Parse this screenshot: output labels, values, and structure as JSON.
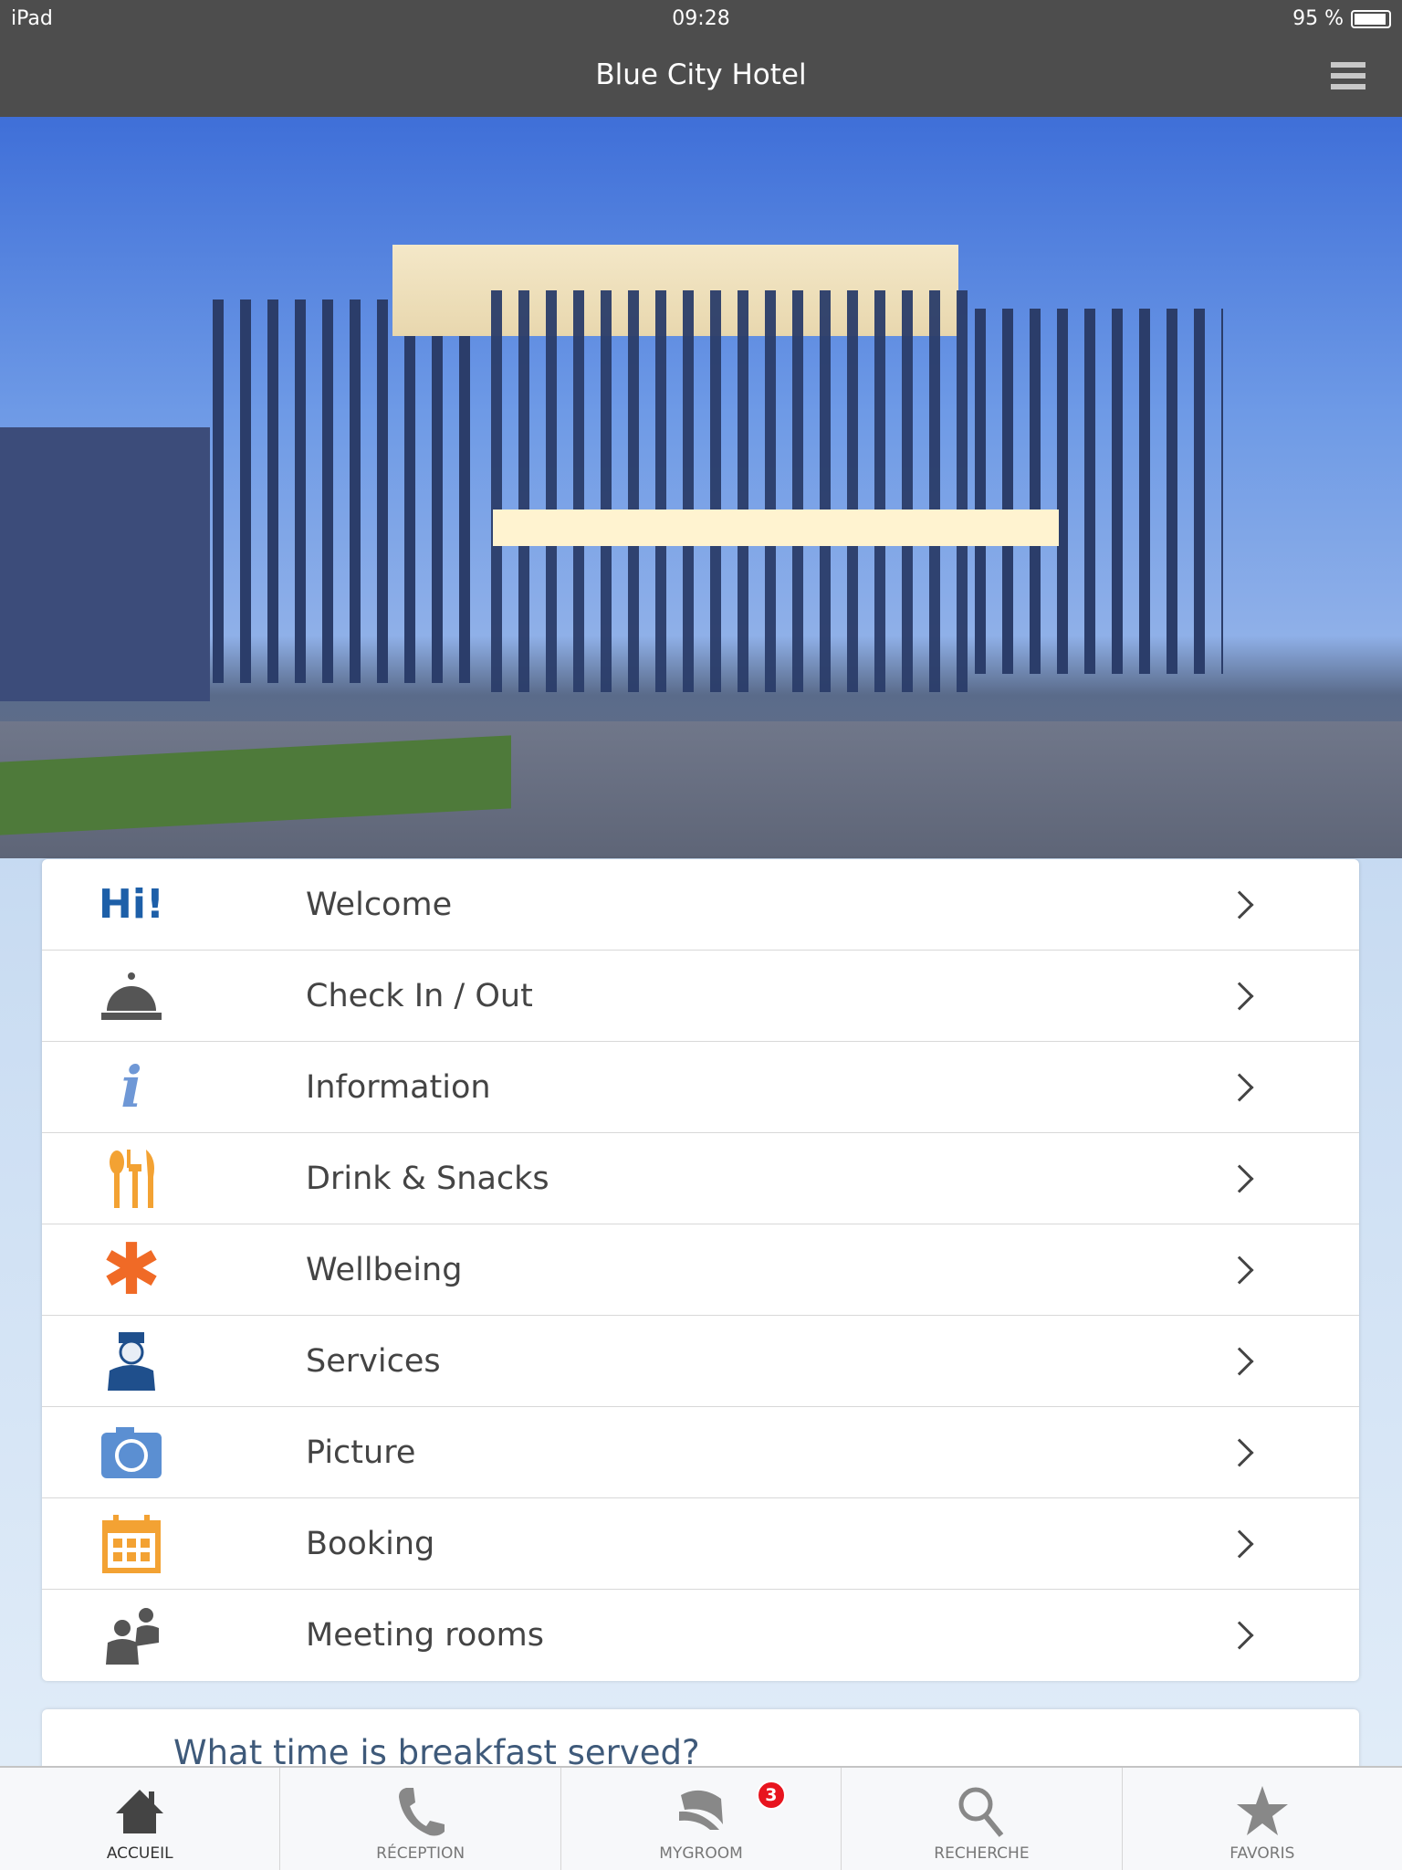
{
  "status_bar": {
    "device": "iPad",
    "time": "09:28",
    "battery": "95 %",
    "battery_level": 0.95
  },
  "header": {
    "title": "Blue City Hotel",
    "menu_icon": "hamburger-icon"
  },
  "menu": {
    "items": [
      {
        "label": "Welcome",
        "icon": "hi-icon",
        "icon_text": "Hi!",
        "color": "#1d5fa8"
      },
      {
        "label": "Check In / Out",
        "icon": "reception-bell-icon",
        "color": "#555555"
      },
      {
        "label": "Information",
        "icon": "info-icon",
        "color": "#6f98d6"
      },
      {
        "label": "Drink & Snacks",
        "icon": "cutlery-icon",
        "color": "#f3a233"
      },
      {
        "label": "Wellbeing",
        "icon": "flower-icon",
        "color": "#f06a26"
      },
      {
        "label": "Services",
        "icon": "bellboy-icon",
        "color": "#1f4f8c"
      },
      {
        "label": "Picture",
        "icon": "camera-icon",
        "color": "#5b8fd2"
      },
      {
        "label": "Booking",
        "icon": "calendar-icon",
        "color": "#f3a233"
      },
      {
        "label": "Meeting rooms",
        "icon": "people-icon",
        "color": "#555555"
      }
    ]
  },
  "faq": {
    "question": "What time is breakfast served?"
  },
  "tabbar": {
    "items": [
      {
        "label": "ACCUEIL",
        "icon": "home-icon",
        "active": true
      },
      {
        "label": "RÉCEPTION",
        "icon": "phone-icon"
      },
      {
        "label": "MYGROOM",
        "icon": "mygroom-icon",
        "badge": "3"
      },
      {
        "label": "RECHERCHE",
        "icon": "search-icon"
      },
      {
        "label": "FAVORIS",
        "icon": "star-icon"
      }
    ]
  }
}
